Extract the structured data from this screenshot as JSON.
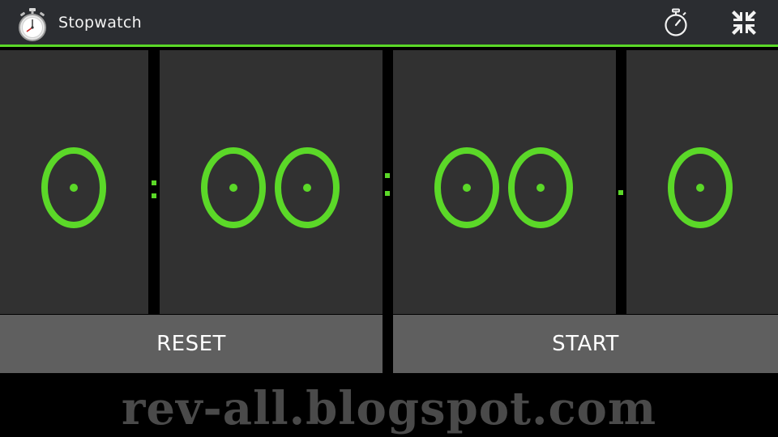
{
  "action_bar": {
    "title": "Stopwatch",
    "app_icon": "stopwatch-app-icon",
    "lap_icon": "stopwatch-icon",
    "collapse_icon": "collapse-arrows-icon"
  },
  "display": {
    "hours": "0",
    "minutes": [
      "0",
      "0"
    ],
    "seconds": [
      "0",
      "0"
    ],
    "tenths": "0"
  },
  "buttons": {
    "reset_label": "RESET",
    "start_label": "START"
  },
  "watermark": "rev-all.blogspot.com",
  "colors": {
    "accent": "#5bd828",
    "bar_bg": "#2b2d31",
    "panel_bg": "#313131",
    "button_bg": "#5f5f5f",
    "background": "#000000"
  }
}
